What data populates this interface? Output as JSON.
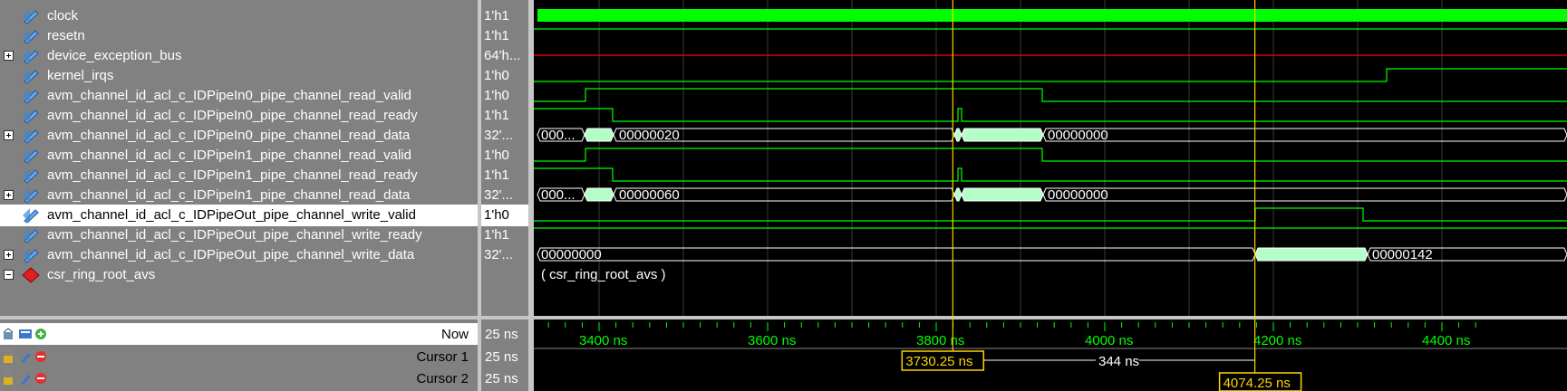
{
  "signals": [
    {
      "name": "clock",
      "value": "1'h1",
      "expander": "none",
      "icon": "wave-icon"
    },
    {
      "name": "resetn",
      "value": "1'h1",
      "expander": "none",
      "icon": "wave-icon"
    },
    {
      "name": "device_exception_bus",
      "value": "64'h...",
      "expander": "plus",
      "icon": "wave-icon"
    },
    {
      "name": "kernel_irqs",
      "value": "1'h0",
      "expander": "none",
      "icon": "wave-icon"
    },
    {
      "name": "avm_channel_id_acl_c_IDPipeIn0_pipe_channel_read_valid",
      "value": "1'h0",
      "expander": "none",
      "icon": "wave-icon"
    },
    {
      "name": "avm_channel_id_acl_c_IDPipeIn0_pipe_channel_read_ready",
      "value": "1'h1",
      "expander": "none",
      "icon": "wave-icon"
    },
    {
      "name": "avm_channel_id_acl_c_IDPipeIn0_pipe_channel_read_data",
      "value": "32'...",
      "expander": "plus",
      "icon": "wave-icon"
    },
    {
      "name": "avm_channel_id_acl_c_IDPipeIn1_pipe_channel_read_valid",
      "value": "1'h0",
      "expander": "none",
      "icon": "wave-icon"
    },
    {
      "name": "avm_channel_id_acl_c_IDPipeIn1_pipe_channel_read_ready",
      "value": "1'h1",
      "expander": "none",
      "icon": "wave-icon"
    },
    {
      "name": "avm_channel_id_acl_c_IDPipeIn1_pipe_channel_read_data",
      "value": "32'...",
      "expander": "plus",
      "icon": "wave-icon"
    },
    {
      "name": "avm_channel_id_acl_c_IDPipeOut_pipe_channel_write_valid",
      "value": "1'h0",
      "expander": "none",
      "icon": "wave-icon",
      "selected": true
    },
    {
      "name": "avm_channel_id_acl_c_IDPipeOut_pipe_channel_write_ready",
      "value": "1'h1",
      "expander": "none",
      "icon": "wave-icon"
    },
    {
      "name": "avm_channel_id_acl_c_IDPipeOut_pipe_channel_write_data",
      "value": "32'...",
      "expander": "plus",
      "icon": "wave-icon"
    },
    {
      "name": "csr_ring_root_avs",
      "value": "",
      "expander": "minus",
      "icon": "diamond-icon"
    }
  ],
  "bus_labels": {
    "in0_data_left": "000...",
    "in0_data_a": "00000020",
    "in0_data_b": "00000000",
    "in1_data_left": "000...",
    "in1_data_a": "00000060",
    "in1_data_b": "00000000",
    "out_data_a": "00000000",
    "out_data_b": "00000142",
    "group_label": "( csr_ring_root_avs )"
  },
  "timeline": {
    "now_label": "Now",
    "now_value": "25 ns",
    "cursors": [
      {
        "label": "Cursor 1",
        "value": "25 ns",
        "time": "3730.25 ns"
      },
      {
        "label": "Cursor 2",
        "value": "25 ns",
        "time": "4074.25 ns"
      }
    ],
    "delta": "344 ns",
    "ticks": [
      "3400 ns",
      "3600 ns",
      "3800 ns",
      "4000 ns",
      "4200 ns",
      "4400 ns"
    ]
  },
  "colors": {
    "wave": "#00ff00",
    "bus_fill": "#b4ffc8",
    "cursor": "#ffd400",
    "panel": "#818181",
    "error_line": "#ff0000"
  }
}
